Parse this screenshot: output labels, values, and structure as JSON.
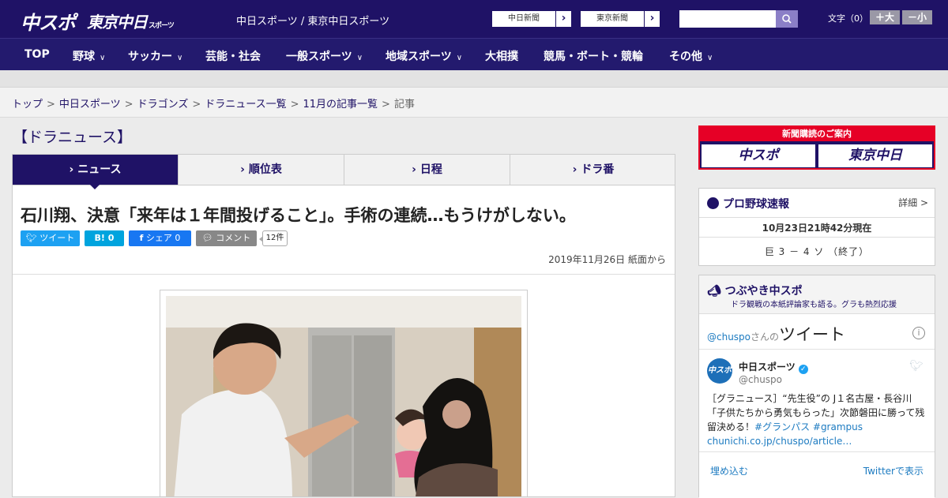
{
  "header": {
    "logo_main": "中スポ",
    "logo_tokyo": "東京中日",
    "logo_tokyo_small": "スポーツ",
    "site_links": "中日スポーツ / 東京中日スポーツ",
    "paper_btn1": "中日新聞",
    "paper_btn2": "東京新聞",
    "font_label": "文字（0）",
    "font_big": "＋大",
    "font_small": "－小",
    "search_placeholder": ""
  },
  "nav": {
    "items": [
      "TOP",
      "野球",
      "サッカー",
      "芸能・社会",
      "一般スポーツ",
      "地域スポーツ",
      "大相撲",
      "競馬・ボート・競輪",
      "その他"
    ],
    "chevron": "⌄"
  },
  "breadcrumb": {
    "items": [
      "トップ",
      "中日スポーツ",
      "ドラゴンズ",
      "ドラニュース一覧",
      "11月の記事一覧"
    ],
    "current": "記事",
    "sep": ">"
  },
  "section_title": "【ドラニュース】",
  "tabs": [
    "ニュース",
    "順位表",
    "日程",
    "ドラ番"
  ],
  "article": {
    "title": "石川翔、決意「来年は１年間投げること」。手術の連続…もうけがしない。",
    "share": {
      "tweet": "ツイート",
      "hatena": "B! 0",
      "facebook": "シェア 0",
      "comment": "コメント",
      "count": "12件"
    },
    "date": "2019年11月26日 紙面から"
  },
  "sidebar": {
    "subscribe_header": "新聞購読のご案内",
    "subscribe_btn1": "中スポ",
    "subscribe_btn2": "東京中日",
    "pro_title": "プロ野球速報",
    "pro_detail": "詳細 >",
    "pro_time": "10月23日21時42分現在",
    "pro_score": "巨 3 － 4 ソ （終了）",
    "tweet_box_title": "つぶやき中スポ",
    "tweet_box_sub": "ドラ観戦の本紙評論家も語る。グラも熱烈応援",
    "widget": {
      "handle_link": "@chuspo",
      "handle_suffix": "さんの",
      "big": "ツイート",
      "account_name": "中日スポーツ",
      "account_handle": "@chuspo",
      "text1": "［グラニュース］“先生役”の J１名古屋・長谷川「子供たちから勇気もらった」次節磐田に勝って残留決める！",
      "hashtags": "#グランパス #grampus",
      "link": "chunichi.co.jp/chuspo/article…",
      "embed": "埋め込む",
      "view": "Twitterで表示"
    }
  },
  "colors": {
    "brand": "#1f1266",
    "accent_red": "#e60026",
    "twitter": "#1da1f2"
  }
}
